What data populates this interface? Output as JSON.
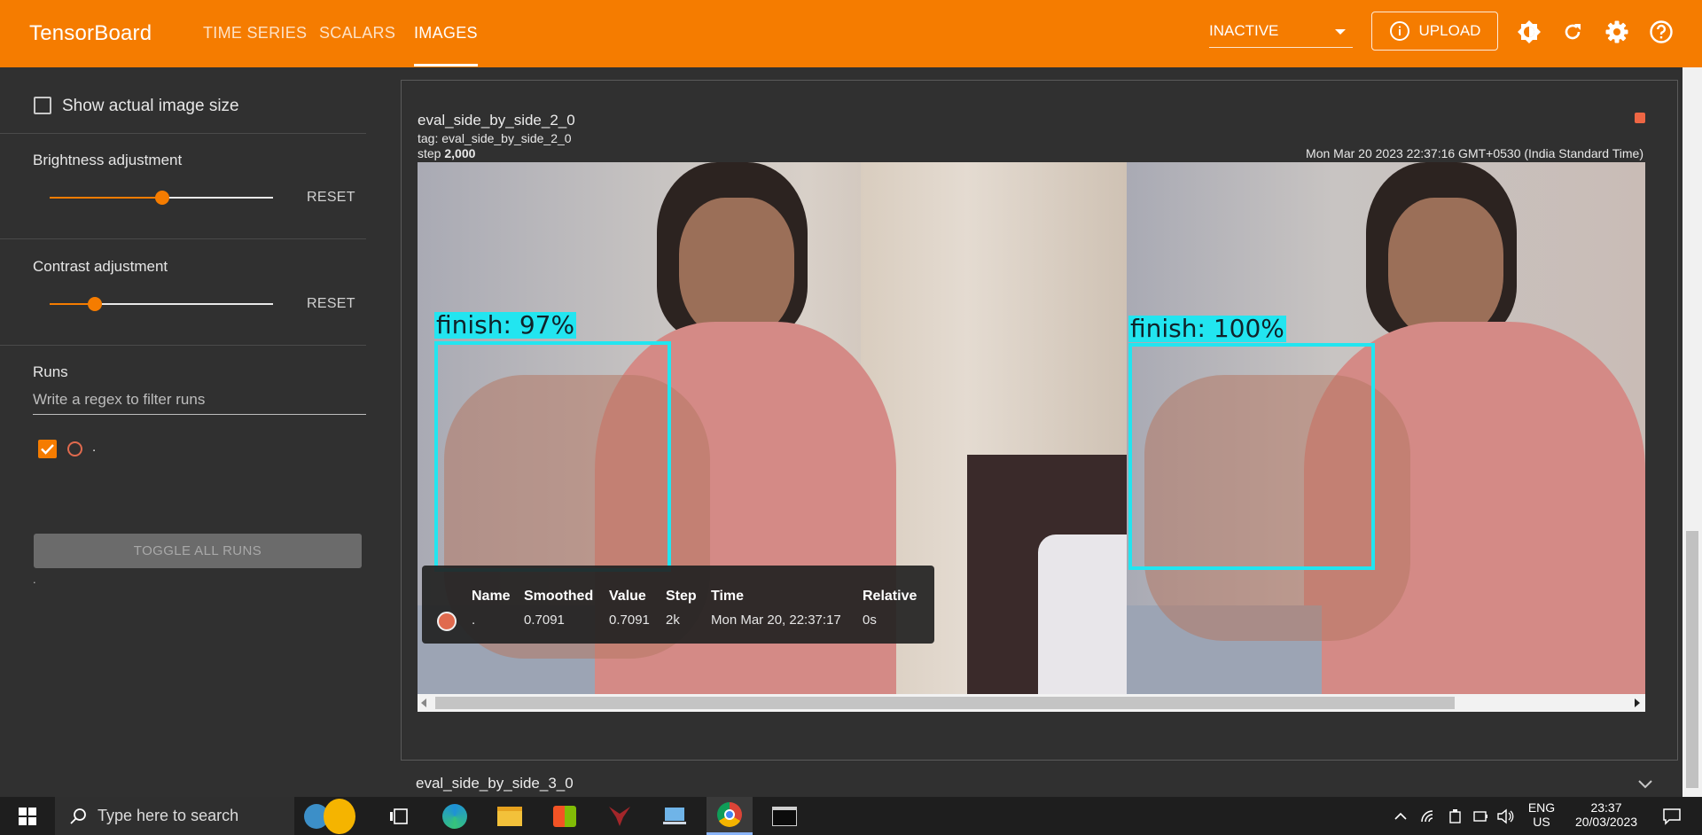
{
  "header": {
    "brand": "TensorBoard",
    "tabs": [
      {
        "label": "TIME SERIES"
      },
      {
        "label": "SCALARS"
      },
      {
        "label": "IMAGES"
      }
    ],
    "status_select": "INACTIVE",
    "upload_label": "UPLOAD"
  },
  "sidebar": {
    "show_actual_size_label": "Show actual image size",
    "brightness_label": "Brightness adjustment",
    "brightness_value": 0.5,
    "contrast_label": "Contrast adjustment",
    "contrast_value": 0.2,
    "reset_label": "RESET",
    "runs_title": "Runs",
    "filter_placeholder": "Write a regex to filter runs",
    "run_name": ".",
    "toggle_all_label": "TOGGLE ALL RUNS",
    "footer_dot": "."
  },
  "card": {
    "title": "eval_side_by_side_2_0",
    "tag": "tag: eval_side_by_side_2_0",
    "step_prefix": "step",
    "step_value": "2,000",
    "timestamp": "Mon Mar 20 2023 22:37:16 GMT+0530 (India Standard Time)",
    "detections": [
      {
        "label": "finish: 97%"
      },
      {
        "label": "finish: 100%"
      }
    ]
  },
  "tooltip": {
    "headers": [
      "Name",
      "Smoothed",
      "Value",
      "Step",
      "Time",
      "Relative"
    ],
    "row": {
      "name": ".",
      "smoothed": "0.7091",
      "value": "0.7091",
      "step": "2k",
      "time": "Mon Mar 20, 22:37:17",
      "relative": "0s"
    }
  },
  "next_card_title": "eval_side_by_side_3_0",
  "taskbar": {
    "search_placeholder": "Type here to search",
    "lang_top": "ENG",
    "lang_bottom": "US",
    "clock_time": "23:37",
    "clock_date": "20/03/2023"
  },
  "colors": {
    "accent": "#f57c00",
    "bbox": "#22e5f0",
    "run_color": "#e06a4e"
  }
}
